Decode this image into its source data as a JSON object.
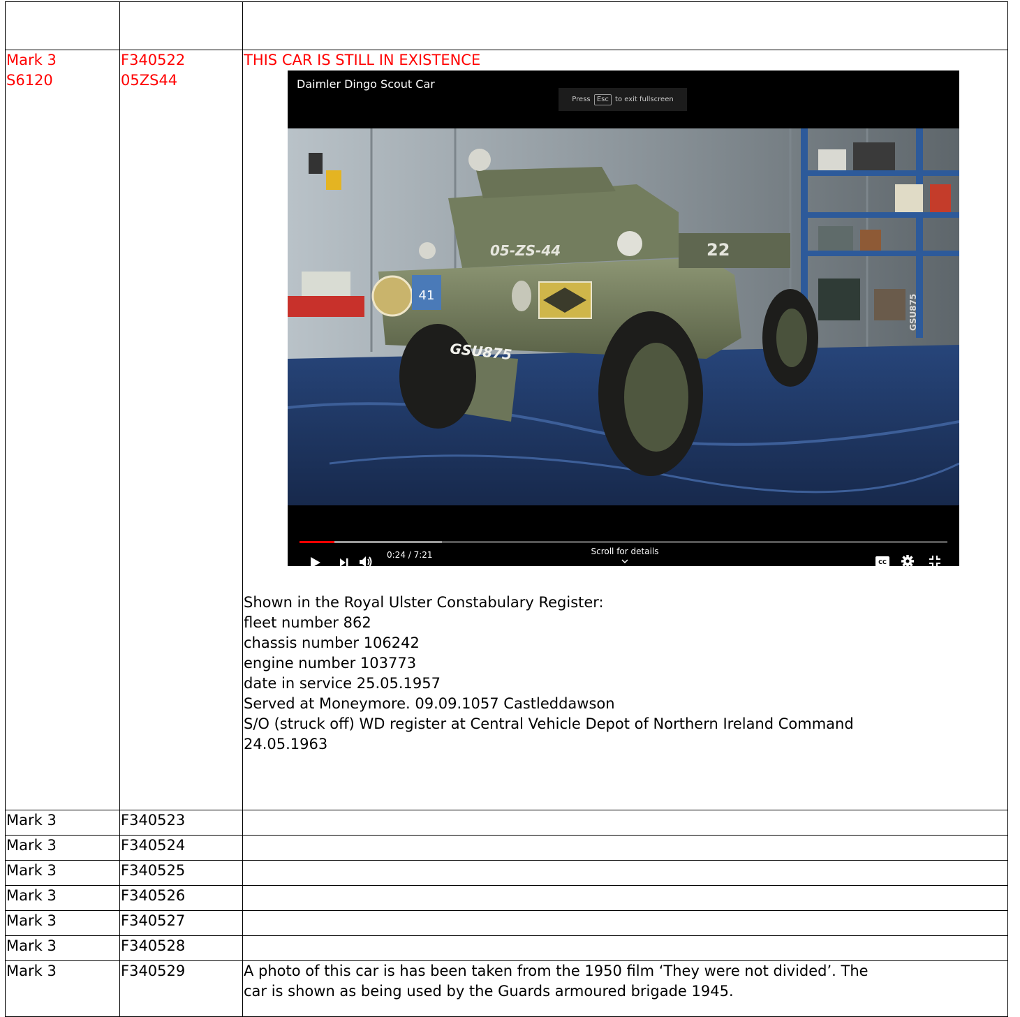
{
  "rows": [
    {
      "mark": "",
      "number": "",
      "notes": ""
    },
    {
      "mark": "Mark 3",
      "mark_line2": "S6120",
      "number": "F340522",
      "number_line2": "05ZS44",
      "heading": "THIS CAR IS STILL IN EXISTENCE",
      "video": {
        "title": "Daimler Dingo Scout Car",
        "esc_before": "Press",
        "esc_key": "Esc",
        "esc_after": "to exit fullscreen",
        "time": "0:24 / 7:21",
        "scroll_label": "Scroll for details",
        "progress": 0.054,
        "buffered": 0.22,
        "icons": [
          "play-icon",
          "next-icon",
          "volume-icon",
          "captions-icon",
          "settings-icon",
          "exit-fullscreen-icon"
        ],
        "vehicle_markings": {
          "hull": "05-ZS-44",
          "turret": "22",
          "plate": "GSU875",
          "side": "GSU875",
          "badge": "41"
        }
      },
      "register_lines": [
        "Shown in the Royal Ulster Constabulary Register:",
        "fleet number 862",
        "chassis number 106242",
        "engine number 103773",
        "date in service 25.05.1957",
        "Served at Moneymore. 09.09.1057 Castleddawson",
        "S/O (struck off) WD register at Central Vehicle Depot of Northern Ireland Command",
        "24.05.1963"
      ]
    },
    {
      "mark": "Mark 3",
      "number": "F340523",
      "notes": ""
    },
    {
      "mark": "Mark 3",
      "number": "F340524",
      "notes": ""
    },
    {
      "mark": "Mark 3",
      "number": "F340525",
      "notes": ""
    },
    {
      "mark": "Mark 3",
      "number": "F340526",
      "notes": ""
    },
    {
      "mark": "Mark 3",
      "number": "F340527",
      "notes": ""
    },
    {
      "mark": "Mark 3",
      "number": "F340528",
      "notes": ""
    },
    {
      "mark": "Mark 3",
      "number": "F340529",
      "notes_lines": [
        "A photo of this car is has been taken from the 1950 film ‘They were not divided’. The",
        "car is shown as being used by the Guards armoured brigade 1945."
      ]
    }
  ],
  "colors": {
    "highlight_text": "#ff0000",
    "player_bg": "#000000",
    "progress_played": "#ff0000"
  }
}
